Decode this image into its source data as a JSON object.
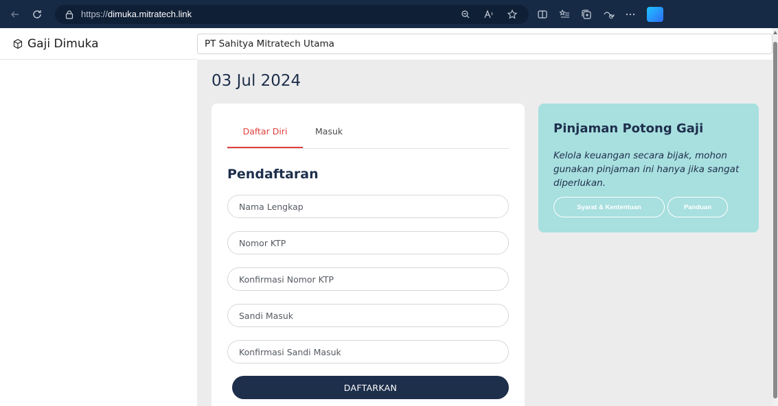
{
  "browser": {
    "url_prefix": "https://",
    "url_domain": "dimuka.mitratech.link"
  },
  "sidebar": {
    "brand_name": "Gaji Dimuka"
  },
  "topbar": {
    "company": "PT Sahitya Mitratech Utama"
  },
  "main": {
    "date": "03 Jul 2024",
    "tabs": [
      {
        "label": "Daftar Diri",
        "active": true
      },
      {
        "label": "Masuk",
        "active": false
      }
    ],
    "form_title": "Pendaftaran",
    "fields": {
      "full_name": "Nama Lengkap",
      "ktp": "Nomor KTP",
      "ktp_confirm": "Konfirmasi Nomor KTP",
      "password": "Sandi Masuk",
      "password_confirm": "Konfirmasi Sandi Masuk"
    },
    "submit_label": "DAFTARKAN"
  },
  "info": {
    "title": "Pinjaman Potong Gaji",
    "text": "Kelola keuangan secara bijak, mohon gunakan pinjaman ini hanya jika sangat diperlukan.",
    "terms_label": "Syarat & Kententuan",
    "guide_label": "Panduan"
  },
  "colors": {
    "navy": "#1e2f4c",
    "accent_red": "#e0403c",
    "info_bg": "#a8dfdf",
    "content_bg": "#ececec"
  }
}
